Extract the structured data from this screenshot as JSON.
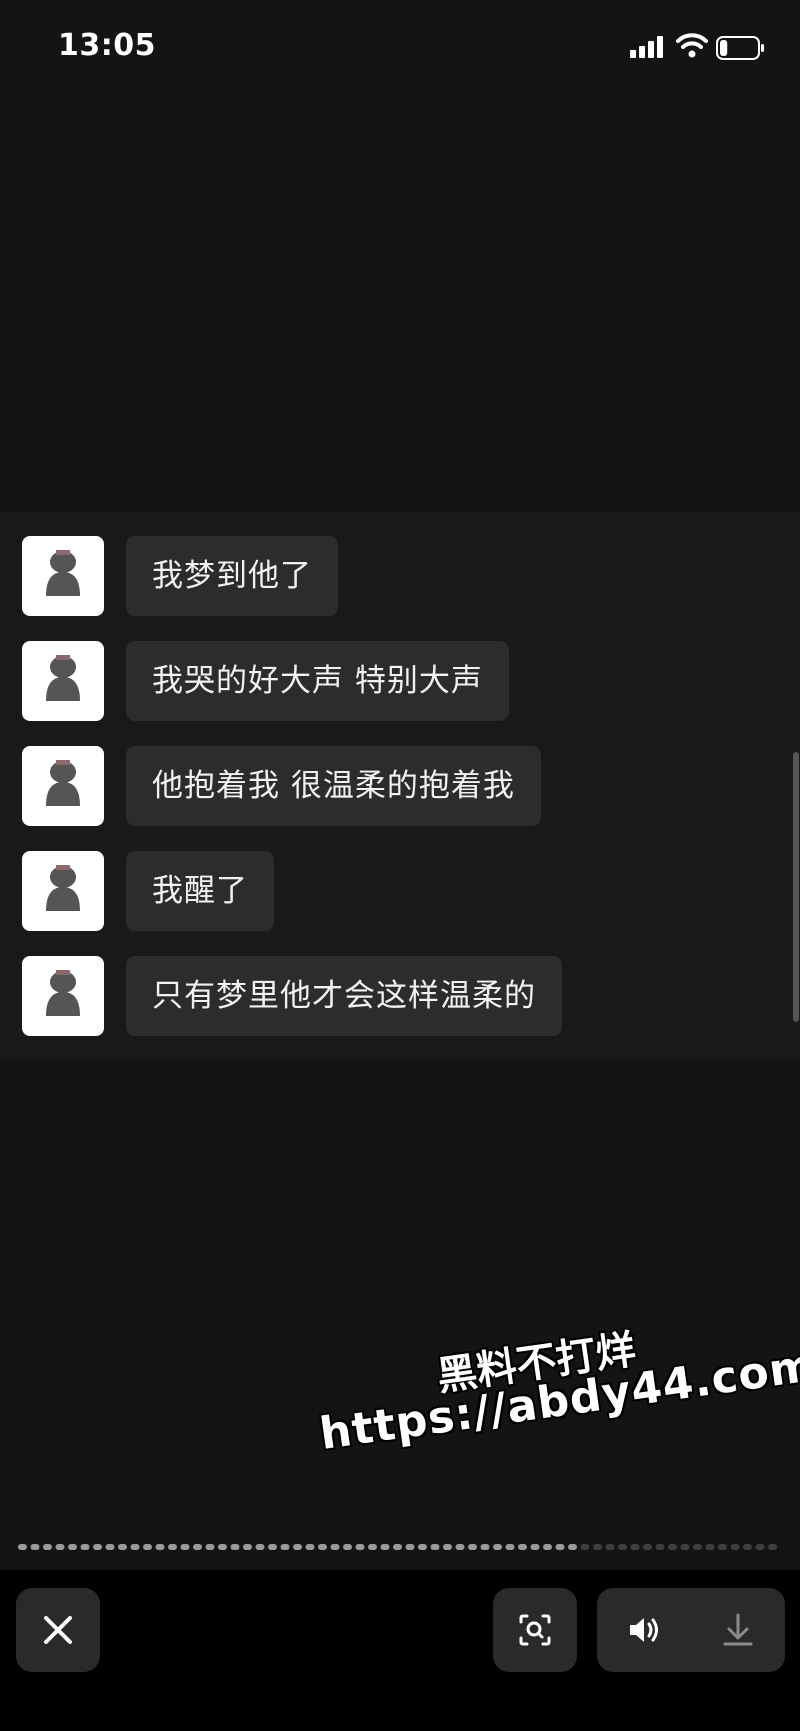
{
  "status_bar": {
    "time": "13:05",
    "icons": [
      "cellular-signal-icon",
      "wifi-icon",
      "battery-icon"
    ],
    "battery_level": 0.2
  },
  "chat": {
    "messages": [
      {
        "sender": "other",
        "avatar": "avatar-icon",
        "text": "我梦到他了"
      },
      {
        "sender": "other",
        "avatar": "avatar-icon",
        "text": "我哭的好大声 特别大声"
      },
      {
        "sender": "other",
        "avatar": "avatar-icon",
        "text": "他抱着我 很温柔的抱着我"
      },
      {
        "sender": "other",
        "avatar": "avatar-icon",
        "text": "我醒了"
      },
      {
        "sender": "other",
        "avatar": "avatar-icon",
        "text": "只有梦里他才会这样温柔的"
      }
    ]
  },
  "watermark": {
    "line1": "黑料不打烊",
    "line2": "https://abdy44.com"
  },
  "player": {
    "progress": 0.74,
    "buttons": [
      "close-icon",
      "scan-icon",
      "volume-icon",
      "download-icon"
    ]
  },
  "colors": {
    "background": "#141414",
    "chat_background": "#191919",
    "bubble": "#2c2c2c",
    "toolbar": "#000000",
    "toolbar_button": "#2a2a2a"
  }
}
